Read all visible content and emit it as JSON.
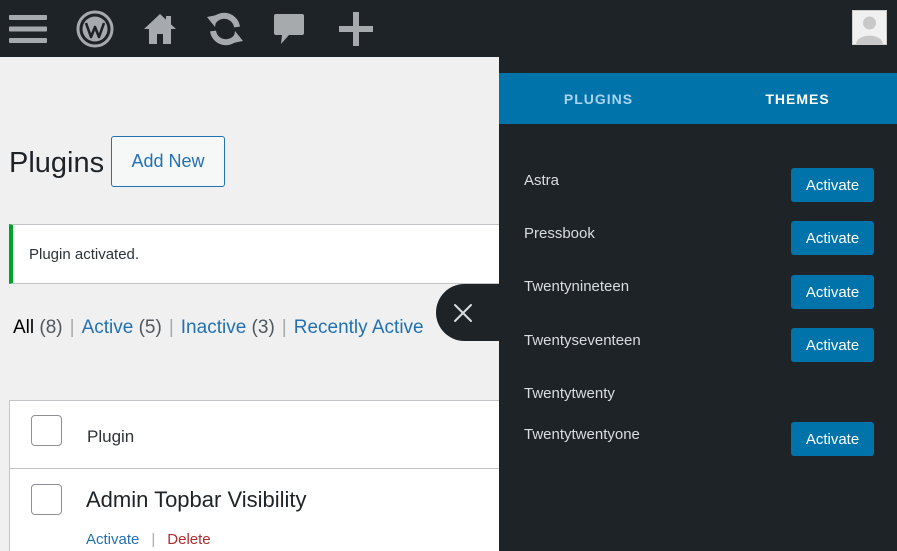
{
  "adminbar": {
    "icons": [
      "menu-icon",
      "wordpress-logo-icon",
      "home-icon",
      "updates-icon",
      "comments-icon",
      "plus-icon",
      "avatar-icon"
    ]
  },
  "main": {
    "title": "Plugins",
    "add_new_label": "Add New",
    "notice": "Plugin activated.",
    "filters": {
      "all": "All",
      "all_count": "(8)",
      "active": "Active",
      "active_count": "(5)",
      "inactive": "Inactive",
      "inactive_count": "(3)",
      "recently_active": "Recently Active",
      "separator": "|"
    },
    "table": {
      "column_plugin": "Plugin",
      "rows": [
        {
          "name": "Admin Topbar Visibility",
          "activate_label": "Activate",
          "delete_label": "Delete",
          "separator": "|"
        }
      ]
    }
  },
  "panel": {
    "tabs": [
      {
        "label": "PLUGINS",
        "active": false
      },
      {
        "label": "THEMES",
        "active": true
      }
    ],
    "themes": [
      {
        "name": "Astra",
        "button": "Activate"
      },
      {
        "name": "Pressbook",
        "button": "Activate"
      },
      {
        "name": "Twentynineteen",
        "button": "Activate"
      },
      {
        "name": "Twentyseventeen",
        "button": "Activate"
      },
      {
        "name": "Twentytwenty",
        "button": ""
      },
      {
        "name": "Twentytwentyone",
        "button": "Activate"
      }
    ]
  },
  "colors": {
    "adminbar_bg": "#1d2327",
    "tab_bar_bg": "#0073aa",
    "button_bg": "#0073aa",
    "link": "#2271b1",
    "notice_success": "#00a32a",
    "delete": "#b32d2e"
  }
}
